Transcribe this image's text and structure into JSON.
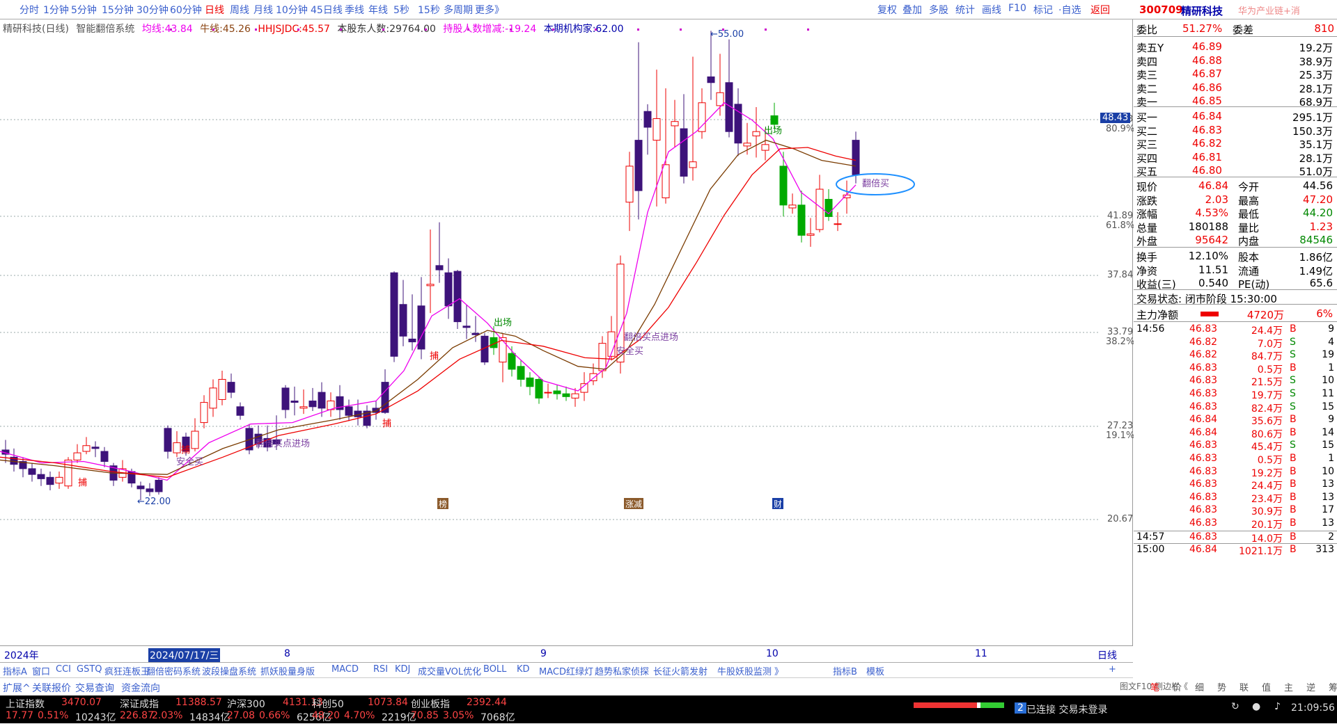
{
  "toolbar": {
    "left": [
      "分时",
      "1分钟",
      "5分钟",
      "15分钟",
      "30分钟",
      "60分钟",
      "日线",
      "周线",
      "月线",
      "10分钟",
      "45日线",
      "季线",
      "年线",
      "5秒",
      "15秒",
      "多周期",
      "更多》"
    ],
    "right": [
      "复权",
      "叠加",
      "多股",
      "统计",
      "画线",
      "F10",
      "标记",
      "·自选",
      "返回"
    ],
    "active": "日线"
  },
  "title": {
    "name": "精研科技(日线)",
    "indicator": "智能翻倍系统",
    "ma_label": "均线:",
    "ma_value": "43.84",
    "niu_label": "牛线:",
    "niu_value": "45.26",
    "hh_label": "HHJSJDC:",
    "hh_value": "45.57",
    "holders_label": "本股东人数:",
    "holders_value": "29764.00",
    "chg_label": "持股人数增减:",
    "chg_value": "-19.24",
    "inst_label": "本期机构家:",
    "inst_value": "62.00"
  },
  "price_axis": [
    {
      "v": "48.43",
      "p": "80.9%"
    },
    {
      "v": "41.89",
      "p": "61.8%"
    },
    {
      "v": "37.84",
      "p": ""
    },
    {
      "v": "33.79",
      "p": "38.2%"
    },
    {
      "v": "27.23",
      "p": "19.1%"
    },
    {
      "v": "20.67",
      "p": ""
    }
  ],
  "current_price_tag": "48.43",
  "chart_data": {
    "type": "candlestick",
    "high_label": "55.00",
    "low_label": "22.00",
    "annotations": [
      "翻倍买点进场",
      "翻倍买点进场",
      "安全买",
      "安全买",
      "出场",
      "出场",
      "翻倍买",
      "捕",
      "捕",
      "捕",
      "捕"
    ]
  },
  "xaxis": {
    "year": "2024年",
    "cursor": "2024/07/17/三",
    "months": [
      "8",
      "9",
      "10",
      "11"
    ],
    "right": "日线",
    "badges": [
      "榜",
      "涨减",
      "财"
    ]
  },
  "indicator_tabs": [
    "指标A",
    "窗口",
    "CCI",
    "GSTQ",
    "疯狂连板王",
    "翻倍密码系统",
    "波段操盘系统",
    "抓妖股量身版",
    "MACD",
    "RSI",
    "KDJ",
    "成交量VOL优化",
    "BOLL",
    "KD",
    "MACD红绿灯",
    "趋势私家侦探",
    "长征火箭发射",
    "牛股妖股监测",
    "》",
    "指标B",
    "模板",
    "+"
  ],
  "bottom_tabs": [
    "扩展^",
    "关联报价",
    "交易查询",
    "资金流向"
  ],
  "stock": {
    "code": "300709",
    "name": "精研科技",
    "tag": "华为产业链+消"
  },
  "weibi": {
    "l1": "委比",
    "v1": "51.27%",
    "l2": "委差",
    "v2": "810"
  },
  "sells": [
    {
      "l": "卖五Y",
      "p": "46.89",
      "v": "19.2万"
    },
    {
      "l": "卖四",
      "p": "46.88",
      "v": "38.9万"
    },
    {
      "l": "卖三",
      "p": "46.87",
      "v": "25.3万"
    },
    {
      "l": "卖二",
      "p": "46.86",
      "v": "28.1万"
    },
    {
      "l": "卖一",
      "p": "46.85",
      "v": "68.9万"
    }
  ],
  "buys": [
    {
      "l": "买一",
      "p": "46.84",
      "v": "295.1万"
    },
    {
      "l": "买二",
      "p": "46.83",
      "v": "150.3万"
    },
    {
      "l": "买三",
      "p": "46.82",
      "v": "35.1万"
    },
    {
      "l": "买四",
      "p": "46.81",
      "v": "28.1万"
    },
    {
      "l": "买五",
      "p": "46.80",
      "v": "51.0万"
    }
  ],
  "quote": [
    {
      "a": "现价",
      "av": "46.84",
      "ac": "r",
      "b": "今开",
      "bv": "44.56",
      "bc": "k"
    },
    {
      "a": "涨跌",
      "av": "2.03",
      "ac": "r",
      "b": "最高",
      "bv": "47.20",
      "bc": "r"
    },
    {
      "a": "涨幅",
      "av": "4.53%",
      "ac": "r",
      "b": "最低",
      "bv": "44.20",
      "bc": "g"
    },
    {
      "a": "总量",
      "av": "180188",
      "ac": "k",
      "b": "量比",
      "bv": "1.23",
      "bc": "r"
    },
    {
      "a": "外盘",
      "av": "95642",
      "ac": "r",
      "b": "内盘",
      "bv": "84546",
      "bc": "g"
    }
  ],
  "quote2": [
    {
      "a": "换手",
      "av": "12.10%",
      "b": "股本",
      "bv": "1.86亿"
    },
    {
      "a": "净资",
      "av": "11.51",
      "b": "流通",
      "bv": "1.49亿"
    },
    {
      "a": "收益(三)",
      "av": "0.540",
      "b": "PE(动)",
      "bv": "65.6"
    }
  ],
  "trade_state": "交易状态: 闭市阶段 15:30:00",
  "main_flow": {
    "l": "主力净额",
    "v": "4720万",
    "p": "6%"
  },
  "ticks": [
    {
      "t": "14:56",
      "p": "46.83",
      "v": "24.4万",
      "s": "B",
      "n": "9"
    },
    {
      "t": "",
      "p": "46.82",
      "v": "7.0万",
      "s": "S",
      "n": "4"
    },
    {
      "t": "",
      "p": "46.82",
      "v": "84.7万",
      "s": "S",
      "n": "19"
    },
    {
      "t": "",
      "p": "46.83",
      "v": "0.5万",
      "s": "B",
      "n": "1"
    },
    {
      "t": "",
      "p": "46.83",
      "v": "21.5万",
      "s": "S",
      "n": "10"
    },
    {
      "t": "",
      "p": "46.83",
      "v": "19.7万",
      "s": "S",
      "n": "11"
    },
    {
      "t": "",
      "p": "46.83",
      "v": "82.4万",
      "s": "S",
      "n": "15"
    },
    {
      "t": "",
      "p": "46.84",
      "v": "35.6万",
      "s": "B",
      "n": "9"
    },
    {
      "t": "",
      "p": "46.84",
      "v": "80.6万",
      "s": "B",
      "n": "14"
    },
    {
      "t": "",
      "p": "46.83",
      "v": "45.4万",
      "s": "S",
      "n": "15"
    },
    {
      "t": "",
      "p": "46.83",
      "v": "0.5万",
      "s": "B",
      "n": "1"
    },
    {
      "t": "",
      "p": "46.83",
      "v": "19.2万",
      "s": "B",
      "n": "10"
    },
    {
      "t": "",
      "p": "46.83",
      "v": "24.4万",
      "s": "B",
      "n": "13"
    },
    {
      "t": "",
      "p": "46.83",
      "v": "23.4万",
      "s": "B",
      "n": "13"
    },
    {
      "t": "",
      "p": "46.83",
      "v": "30.9万",
      "s": "B",
      "n": "17"
    },
    {
      "t": "",
      "p": "46.83",
      "v": "20.1万",
      "s": "B",
      "n": "13"
    },
    {
      "t": "14:57",
      "p": "46.83",
      "v": "14.0万",
      "s": "B",
      "n": "2"
    },
    {
      "t": "15:00",
      "p": "46.84",
      "v": "1021.1万",
      "s": "B",
      "n": "313"
    }
  ],
  "rp_tabs": [
    "笔",
    "价",
    "细",
    "势",
    "联",
    "值",
    "主",
    "逆",
    "筹"
  ],
  "rp_footer": "图文F10 侧边栏《",
  "indices": [
    {
      "name": "上证指数",
      "val": "3470.07",
      "chg": "17.77",
      "pct": "0.51%",
      "amt": "10243亿"
    },
    {
      "name": "深证成指",
      "val": "11388.57",
      "chg": "226.87",
      "pct": "2.03%",
      "amt": "14834亿"
    },
    {
      "name": "沪深300",
      "val": "4131.13",
      "chg": "27.08",
      "pct": "0.66%",
      "amt": "6256亿"
    },
    {
      "name": "科创50",
      "val": "1073.84",
      "chg": "48.20",
      "pct": "4.70%",
      "amt": "2219亿"
    },
    {
      "name": "创业板指",
      "val": "2392.44",
      "chg": "70.85",
      "pct": "3.05%",
      "amt": "7068亿"
    }
  ],
  "conn": {
    "num": "2",
    "text": "已连接 交易未登录",
    "time": "21:09:56"
  }
}
